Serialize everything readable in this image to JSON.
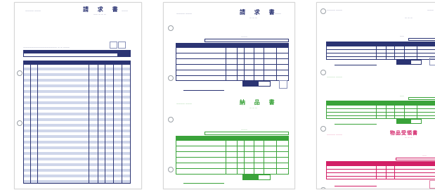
{
  "colors": {
    "navy": "#2b3473",
    "green": "#3aa33a",
    "magenta": "#d21f66",
    "paper": "#ffffff",
    "stripe": "#cfd6ea"
  },
  "sheet1": {
    "title": "請 求 書"
  },
  "sheet2": {
    "title_top": "請 求 書",
    "title_bottom": "納 品 書"
  },
  "sheet3": {
    "title_pink": "物品受領書"
  }
}
